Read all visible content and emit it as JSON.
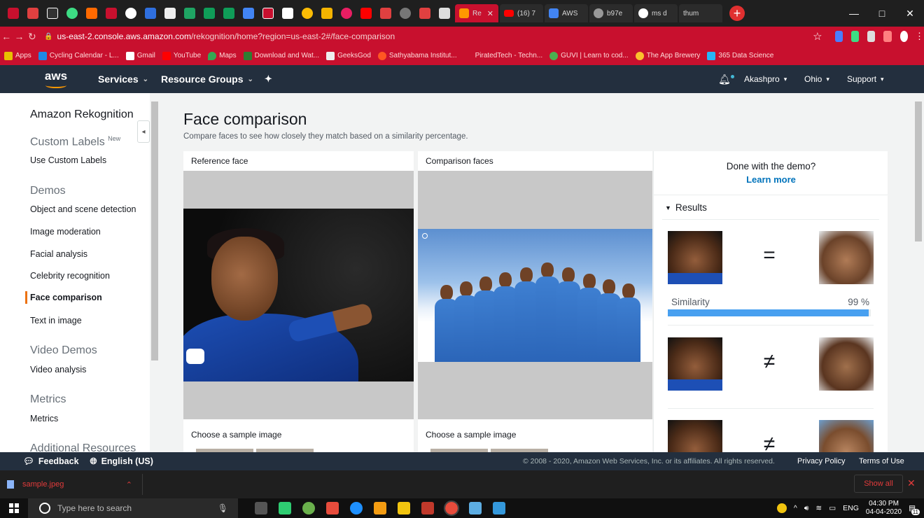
{
  "browser": {
    "tab_titles": [
      "Re",
      "(16) 7",
      "AWS",
      "b97e",
      "ms d",
      "thum"
    ],
    "url_host": "us-east-2.console.aws.amazon.com",
    "url_path": "/rekognition/home?region=us-east-2#/face-comparison",
    "bookmarks": [
      "Apps",
      "Cycling Calendar - L...",
      "Gmail",
      "YouTube",
      "Maps",
      "Download and Wat...",
      "GeeksGod",
      "Sathyabama Institut...",
      "PiratedTech - Techn...",
      "GUVI | Learn to cod...",
      "The App Brewery",
      "365 Data Science"
    ]
  },
  "aws_nav": {
    "logo": "aws",
    "services": "Services",
    "resource_groups": "Resource Groups",
    "user": "Akashpro",
    "region": "Ohio",
    "support": "Support"
  },
  "sidebar": {
    "title": "Amazon Rekognition",
    "custom_labels_header": "Custom Labels",
    "new_badge": "New",
    "use_custom_labels": "Use Custom Labels",
    "demos_header": "Demos",
    "demos": [
      "Object and scene detection",
      "Image moderation",
      "Facial analysis",
      "Celebrity recognition",
      "Face comparison",
      "Text in image"
    ],
    "video_demos_header": "Video Demos",
    "video_analysis": "Video analysis",
    "metrics_header": "Metrics",
    "metrics": "Metrics",
    "additional_header": "Additional Resources"
  },
  "main": {
    "title": "Face comparison",
    "subtitle": "Compare faces to see how closely they match based on a similarity percentage.",
    "reference_label": "Reference face",
    "comparison_label": "Comparison faces",
    "sample_label_left": "Choose a sample image",
    "sample_label_right": "Choose a sample image"
  },
  "results": {
    "done_text": "Done with the demo?",
    "learn_more": "Learn more",
    "header": "Results",
    "matches": [
      {
        "symbol": "=",
        "similarity": 99
      },
      {
        "symbol": "≠"
      },
      {
        "symbol": "≠"
      }
    ],
    "similarity_label": "Similarity",
    "similarity_value": "99 %"
  },
  "footer": {
    "feedback": "Feedback",
    "language": "English (US)",
    "copyright": "© 2008 - 2020, Amazon Web Services, Inc. or its affiliates. All rights reserved.",
    "privacy": "Privacy Policy",
    "terms": "Terms of Use"
  },
  "downloads": {
    "file": "sample.jpeg",
    "show_all": "Show all"
  },
  "taskbar": {
    "search_placeholder": "Type here to search",
    "lang": "ENG",
    "time": "04:30 PM",
    "date": "04-04-2020",
    "notifications": "11"
  }
}
